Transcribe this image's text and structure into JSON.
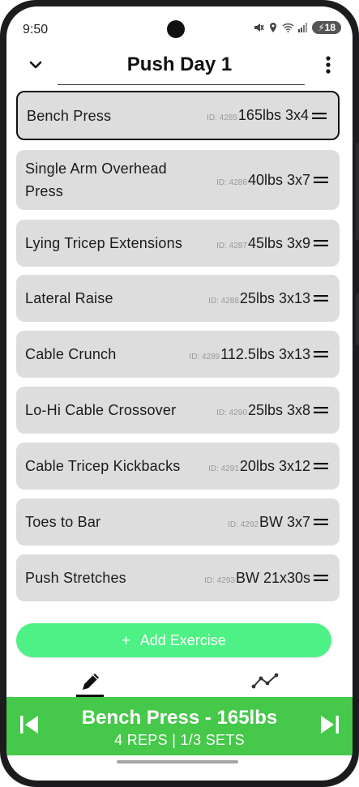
{
  "status_bar": {
    "time": "9:50",
    "battery": "18"
  },
  "header": {
    "title": "Push Day 1"
  },
  "exercises": [
    {
      "name": "Bench Press",
      "id_label": "ID: 4285",
      "detail": "165lbs 3x4",
      "selected": true
    },
    {
      "name": "Single Arm Overhead Press",
      "id_label": "ID: 4286",
      "detail": "40lbs 3x7",
      "selected": false
    },
    {
      "name": "Lying Tricep Extensions",
      "id_label": "ID: 4287",
      "detail": "45lbs 3x9",
      "selected": false
    },
    {
      "name": "Lateral Raise",
      "id_label": "ID: 4288",
      "detail": "25lbs 3x13",
      "selected": false
    },
    {
      "name": "Cable Crunch",
      "id_label": "ID: 4289",
      "detail": "112.5lbs 3x13",
      "selected": false
    },
    {
      "name": "Lo-Hi Cable Crossover",
      "id_label": "ID: 4290",
      "detail": "25lbs 3x8",
      "selected": false
    },
    {
      "name": "Cable Tricep Kickbacks",
      "id_label": "ID: 4291",
      "detail": "20lbs 3x12",
      "selected": false
    },
    {
      "name": "Toes to Bar",
      "id_label": "ID: 4292",
      "detail": "BW 3x7",
      "selected": false
    },
    {
      "name": "Push Stretches",
      "id_label": "ID: 4293",
      "detail": "BW 21x30s",
      "selected": false
    }
  ],
  "add_button": {
    "plus": "+",
    "label": "Add Exercise"
  },
  "tabs": {
    "edit_icon": "pencil-icon",
    "chart_icon": "line-chart-icon"
  },
  "player": {
    "title": "Bench Press - 165lbs",
    "subtitle": "4 REPS | 1/3 SETS"
  },
  "colors": {
    "accent_green": "#4ef185",
    "player_green": "#46c84a",
    "row_gray": "#dddddd"
  }
}
